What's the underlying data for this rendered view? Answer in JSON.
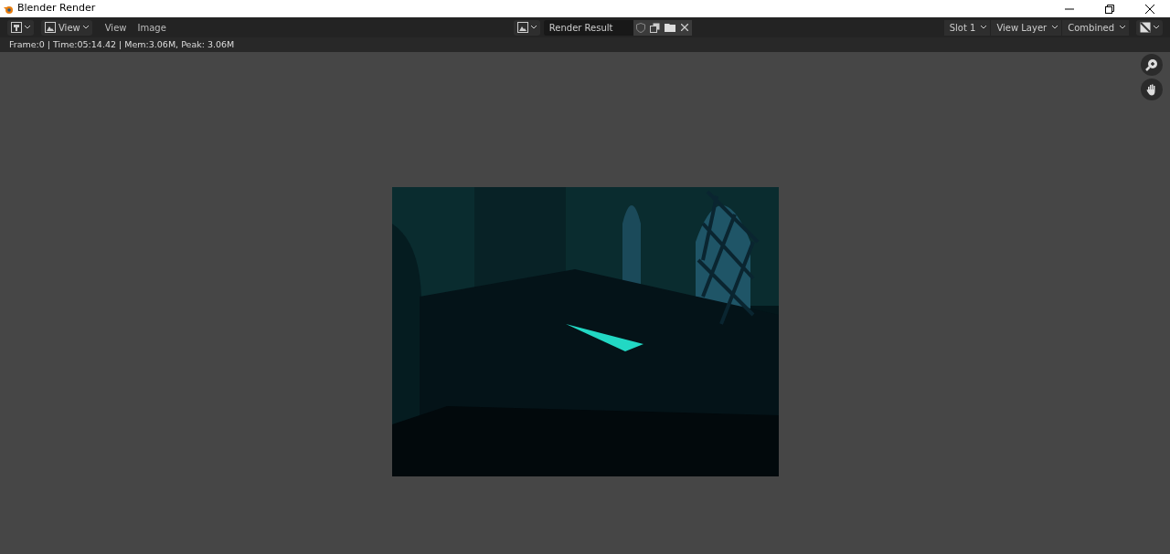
{
  "window": {
    "title": "Blender Render"
  },
  "header": {
    "view_dropdown": "View",
    "menus": [
      "View",
      "Image"
    ],
    "image_name": "Render Result",
    "dropdowns": [
      "Slot 1",
      "View Layer",
      "Combined"
    ]
  },
  "info": "Frame:0 | Time:05:14.42 | Mem:3.06M, Peak: 3.06M"
}
